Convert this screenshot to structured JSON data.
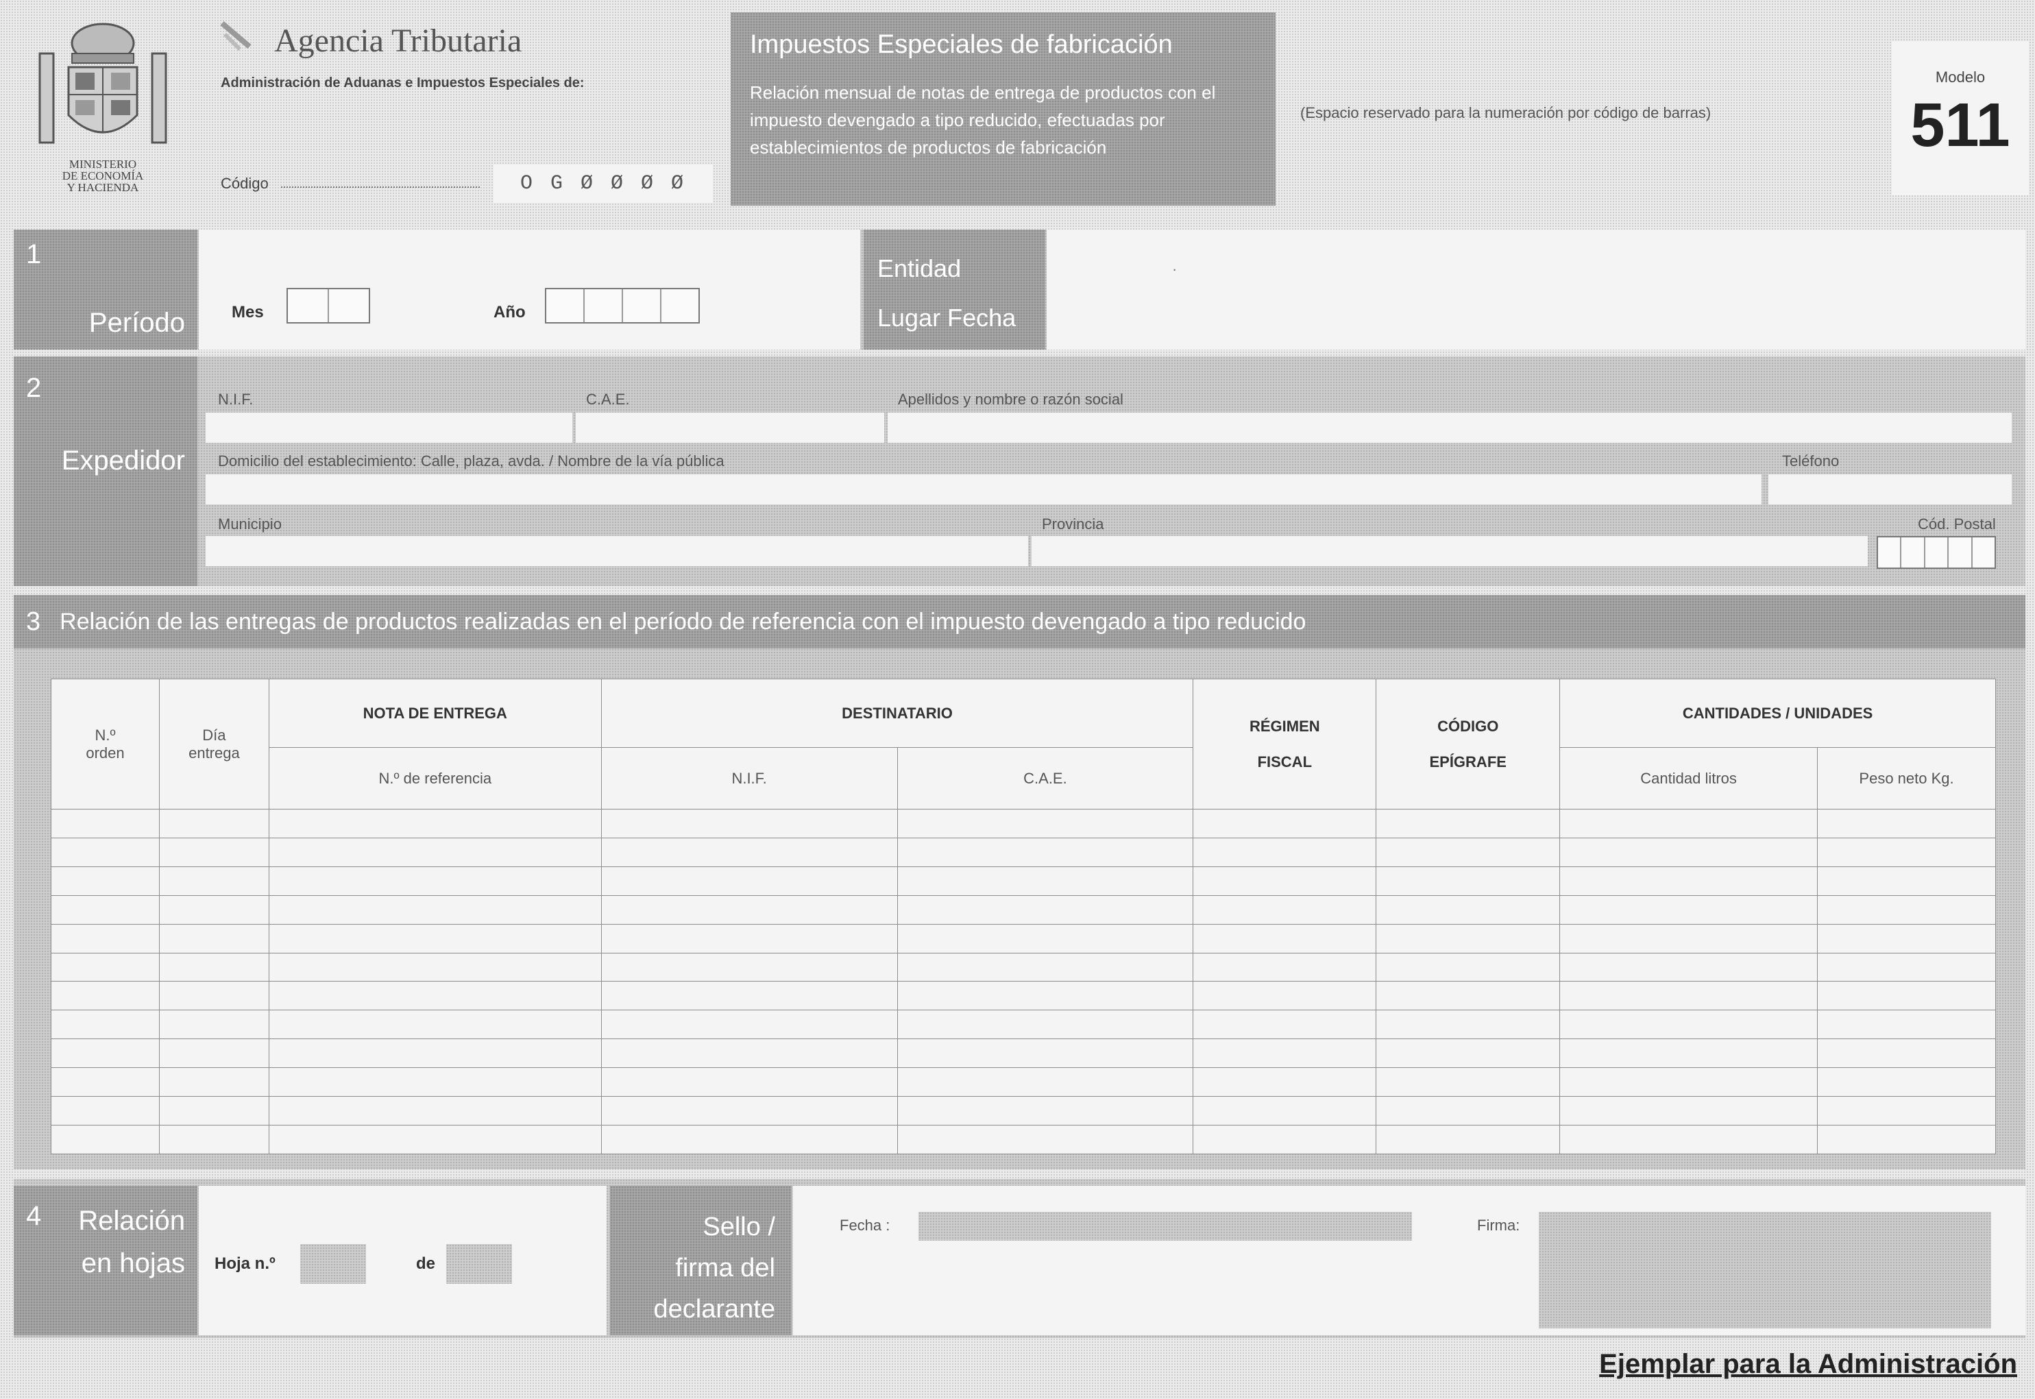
{
  "header": {
    "ministry": [
      "MINISTERIO",
      "DE ECONOMÍA",
      "Y HACIENDA"
    ],
    "agency": "Agencia Tributaria",
    "administration": "Administración de Aduanas e Impuestos Especiales de:",
    "code_label": "Código",
    "code_value": "O G Ø Ø Ø Ø",
    "tax_title": "Impuestos Especiales de fabricación",
    "tax_subtitle": "Relación mensual de notas de entrega de productos con el impuesto devengado a tipo reducido, efectuadas por establecimientos de productos de fabricación",
    "barcode_note": "(Espacio reservado para la numeración por código de barras)",
    "modelo_label": "Modelo",
    "modelo_number": "511"
  },
  "section1": {
    "number": "1",
    "title": "Período",
    "month_label": "Mes",
    "year_label": "Año",
    "stamp_label_1": "Entidad",
    "stamp_label_2": "Lugar Fecha",
    "stamp_side_mark": "·"
  },
  "section2": {
    "number": "2",
    "title": "Expedidor",
    "nif_label": "N.I.F.",
    "cae_label": "C.A.E.",
    "name_label": "Apellidos y nombre o razón social",
    "address_label": "Domicilio del establecimiento: Calle, plaza, avda. / Nombre de la vía pública",
    "phone_label": "Teléfono",
    "municipality_label": "Municipio",
    "province_label": "Provincia",
    "postal_label": "Cód. Postal"
  },
  "section3": {
    "number": "3",
    "title": "Relación de las entregas de productos realizadas en el período de referencia con el impuesto devengado a tipo reducido",
    "columns": {
      "order": [
        "N.º",
        "orden"
      ],
      "day": [
        "Día",
        "entrega"
      ],
      "note_group": "NOTA DE ENTREGA",
      "note_ref": "N.º de referencia",
      "recipient_group": "DESTINATARIO",
      "recipient_nif": "N.I.F.",
      "recipient_cae": "C.A.E.",
      "regime": [
        "RÉGIMEN",
        "FISCAL"
      ],
      "code": [
        "CÓDIGO",
        "EPÍGRAFE"
      ],
      "qty_group": "CANTIDADES / UNIDADES",
      "liters": "Cantidad litros",
      "weight": "Peso neto Kg."
    },
    "row_count": 12
  },
  "section4": {
    "number": "4",
    "title": [
      "Relación",
      "en hojas"
    ],
    "sheet_label": "Hoja n.º",
    "of_label": "de",
    "signature_block": [
      "Sello /",
      "firma del",
      "declarante"
    ],
    "date_label": "Fecha :",
    "signature_label": "Firma:"
  },
  "footer": {
    "copy_label": "Ejemplar para la Administración"
  }
}
